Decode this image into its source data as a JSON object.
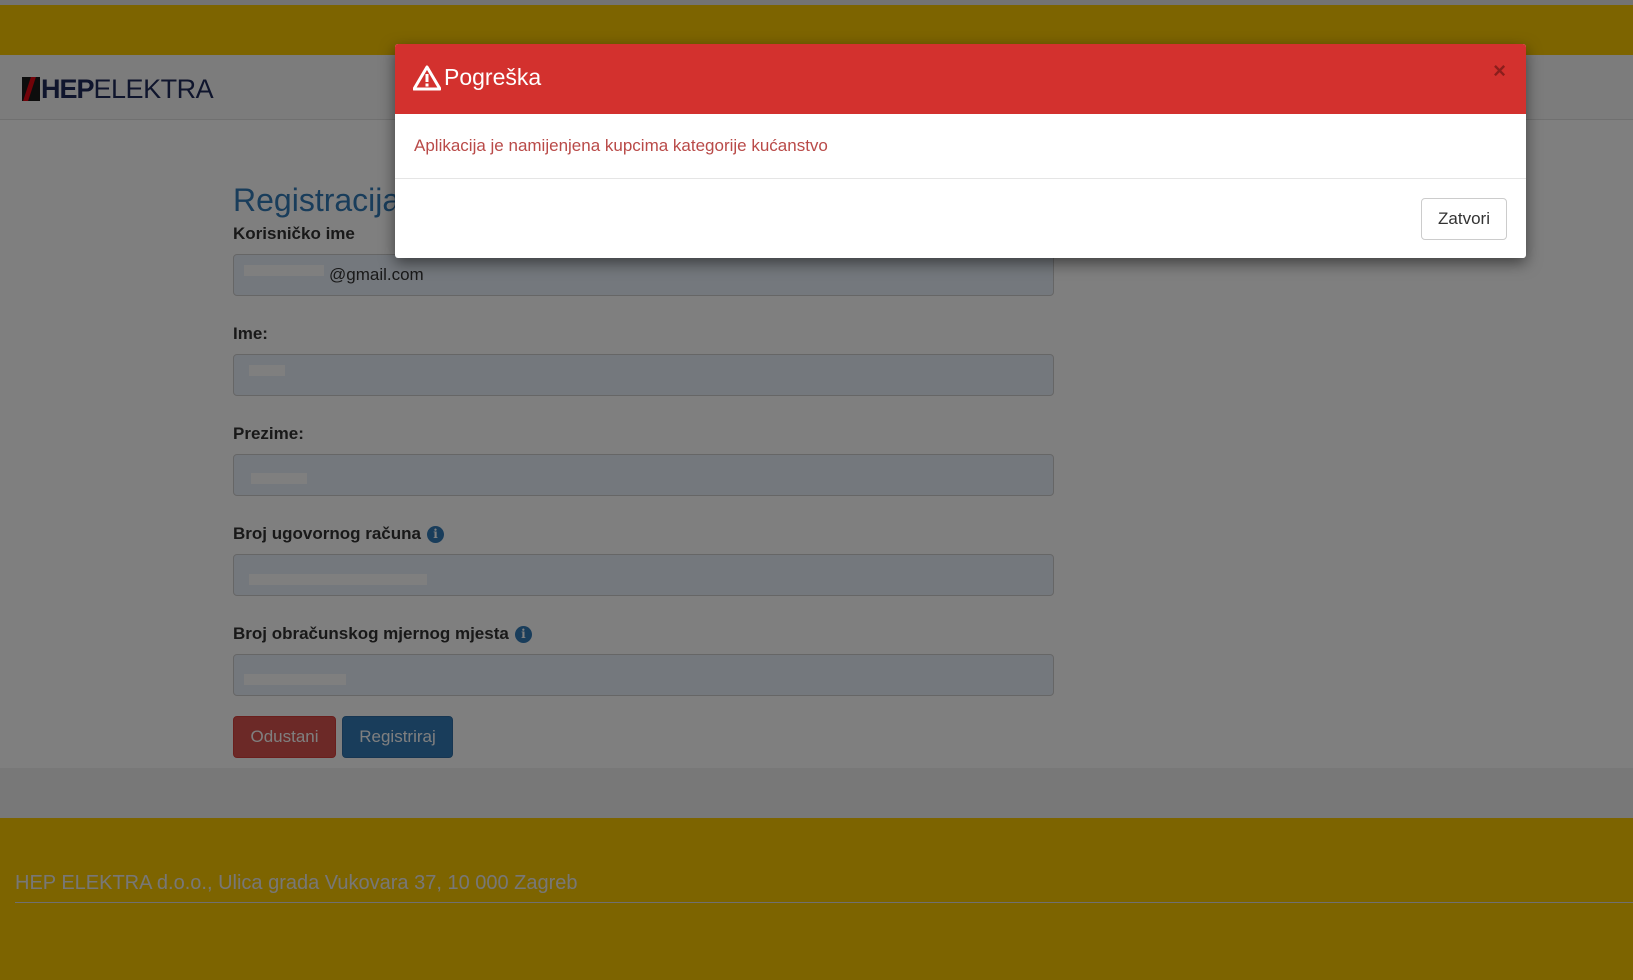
{
  "brand": {
    "logo_bold": "HEP",
    "logo_light": "ELEKTRA"
  },
  "form": {
    "title": "Registracija",
    "fields": [
      {
        "label": "Korisničko ime",
        "value": "@gmail.com",
        "info": false
      },
      {
        "label": "Ime:",
        "value": "",
        "info": false
      },
      {
        "label": "Prezime:",
        "value": "",
        "info": false
      },
      {
        "label": "Broj ugovornog računa",
        "value": "",
        "info": true
      },
      {
        "label": "Broj obračunskog mjernog mjesta",
        "value": "",
        "info": true
      }
    ],
    "cancel_label": "Odustani",
    "submit_label": "Registriraj"
  },
  "footer": {
    "address": "HEP ELEKTRA d.o.o., Ulica grada Vukovara 37, 10 000 Zagreb"
  },
  "modal": {
    "title": "Pogreška",
    "close_symbol": "×",
    "message": "Aplikacija je namijenjena kupcima kategorije kućanstvo",
    "close_button_label": "Zatvori"
  },
  "colors": {
    "brand_yellow": "#fbc900",
    "primary_blue": "#337ab7",
    "danger_red": "#d9534f",
    "modal_header_red": "#d3312e"
  },
  "icons": {
    "modal_title": "warning-icon",
    "field_help": "info-icon"
  }
}
